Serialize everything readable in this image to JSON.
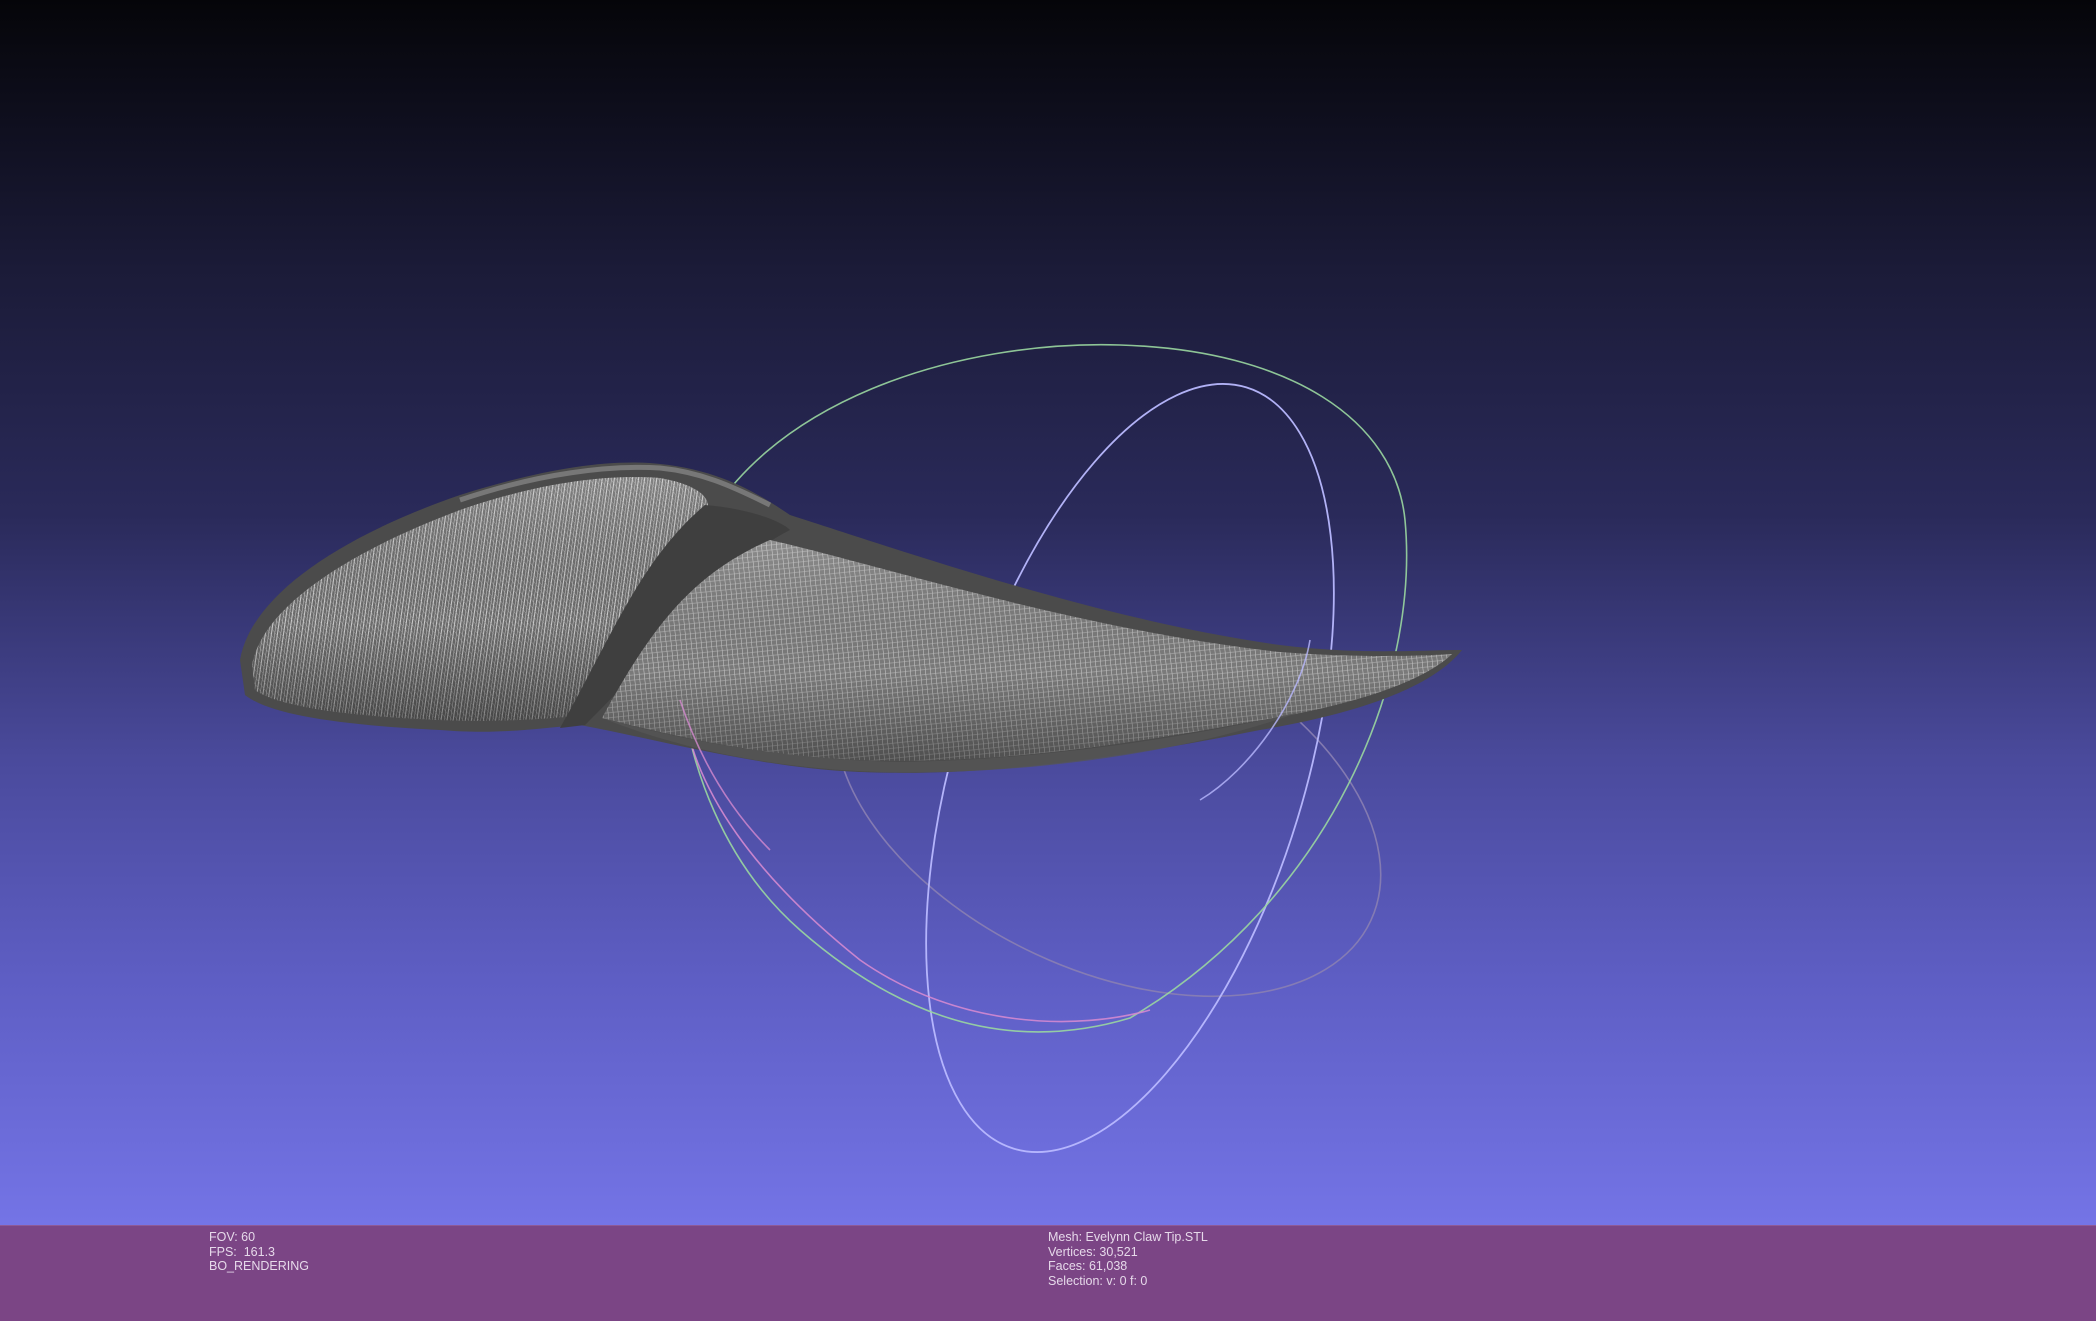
{
  "status_left": {
    "fov": "FOV: 60",
    "fps": "FPS:  161.3",
    "mode": "BO_RENDERING"
  },
  "status_right": {
    "mesh": "Mesh: Evelynn Claw Tip.STL",
    "vertices": "Vertices: 30,521",
    "faces": "Faces: 61,038",
    "selection": "Selection: v: 0 f: 0"
  },
  "colors": {
    "statusbar": "#7b4585",
    "mesh_wire": "#cfcfcf",
    "mesh_edge": "#4a4a4a",
    "trackball_x": "#d48ad0",
    "trackball_y": "#9ad7a0",
    "trackball_z": "#b9b9ff"
  },
  "icons": {
    "trackball": "trackball-gizmo",
    "mesh": "wireframe-mesh"
  }
}
